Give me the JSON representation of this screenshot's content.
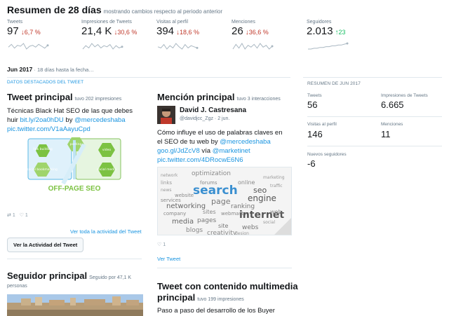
{
  "header": {
    "title": "Resumen de 28 días",
    "subtitle": "mostrando cambios respecto al periodo anterior"
  },
  "stats": [
    {
      "label": "Tweets",
      "value": "97",
      "change": "6,7 %",
      "direction": "down",
      "trend": [
        6,
        9,
        5,
        8,
        7,
        10,
        4,
        7,
        8,
        6,
        9,
        7,
        5,
        8
      ]
    },
    {
      "label": "Impresiones de Tweets",
      "value": "21,4 K",
      "change": "30,6 %",
      "direction": "down",
      "trend": [
        5,
        8,
        6,
        10,
        7,
        9,
        6,
        8,
        7,
        9,
        5,
        8,
        6,
        7
      ]
    },
    {
      "label": "Visitas al perfil",
      "value": "394",
      "change": "18,6 %",
      "direction": "down",
      "trend": [
        7,
        6,
        9,
        5,
        8,
        6,
        10,
        7,
        5,
        9,
        6,
        8,
        7,
        6
      ]
    },
    {
      "label": "Menciones",
      "value": "26",
      "change": "36,6 %",
      "direction": "down",
      "trend": [
        4,
        9,
        5,
        10,
        4,
        8,
        6,
        9,
        5,
        10,
        6,
        8,
        4,
        7
      ]
    },
    {
      "label": "Seguidores",
      "value": "2.013",
      "change": "23",
      "direction": "up",
      "trend": [
        2,
        2,
        3,
        3,
        4,
        4,
        5,
        5,
        6,
        6,
        7,
        7,
        8,
        9
      ]
    }
  ],
  "month": {
    "label": "Jun 2017",
    "sub": "· 18 días hasta la fecha…"
  },
  "highlights_label": "DATOS DESTACADOS DEL TWEET",
  "top_tweet": {
    "title": "Tweet principal",
    "meta": "tuvo 202 impresiones",
    "text_line1": "Técnicas Black Hat SEO de las que debes",
    "text_line2a": "huir ",
    "link1": "bit.ly/2oa0hDU",
    "text_by": " by ",
    "mention": "@mercedeshaba",
    "link2": "pic.twitter.com/V1aAayuCpd",
    "image_words": [
      "link building",
      "posting",
      "video",
      "social bookmarking",
      "social media"
    ],
    "image_caption": "OFF-PAGE SEO",
    "retweets": "1",
    "likes": "1",
    "activity_link": "Ver toda la actividad del Tweet",
    "activity_button": "Ver la Actividad del Tweet"
  },
  "top_mention": {
    "title": "Mención principal",
    "meta": "tuvo 3 interacciones",
    "user_name": "David J. Castresana",
    "user_handle": "@davidjcc_Zgz",
    "date": "· 2 jun.",
    "text_line1": "Cómo influye el uso de palabras claves en",
    "text_line2a": "el SEO de tu web by ",
    "mention1": "@mercedeshaba",
    "link1": "goo.gl/JdZcV8",
    "via": " vía ",
    "mention2": "@marketinet",
    "link2": "pic.twitter.com/4DRocwE6N6",
    "cloud_words": [
      "optimization",
      "network",
      "links",
      "marketing",
      "forums",
      "online",
      "search",
      "seo",
      "engine",
      "website",
      "page",
      "ranking",
      "networking",
      "services",
      "company",
      "webmaster",
      "internet",
      "sites",
      "media",
      "pages",
      "blogs",
      "site",
      "creativity",
      "webs",
      "web",
      "news",
      "traffic",
      "social",
      "design"
    ],
    "likes": "1",
    "view_link": "Ver Tweet"
  },
  "top_follower": {
    "title": "Seguidor principal",
    "meta_line1": "Seguido por 47,1 K",
    "meta_line2": "personas"
  },
  "top_media": {
    "title_line1": "Tweet con contenido multimedia",
    "title_line2": "principal",
    "meta": "tuvo 199 impresiones",
    "text": "Paso a paso del desarrollo de los Buyer"
  },
  "month_summary": {
    "label": "RESUMEN DE JUN 2017",
    "items": [
      {
        "label": "Tweets",
        "value": "56"
      },
      {
        "label": "Impresiones de Tweets",
        "value": "6.665"
      },
      {
        "label": "Visitas al perfil",
        "value": "146"
      },
      {
        "label": "Menciones",
        "value": "11"
      },
      {
        "label": "Nuevos seguidores",
        "value": "-6"
      }
    ]
  }
}
